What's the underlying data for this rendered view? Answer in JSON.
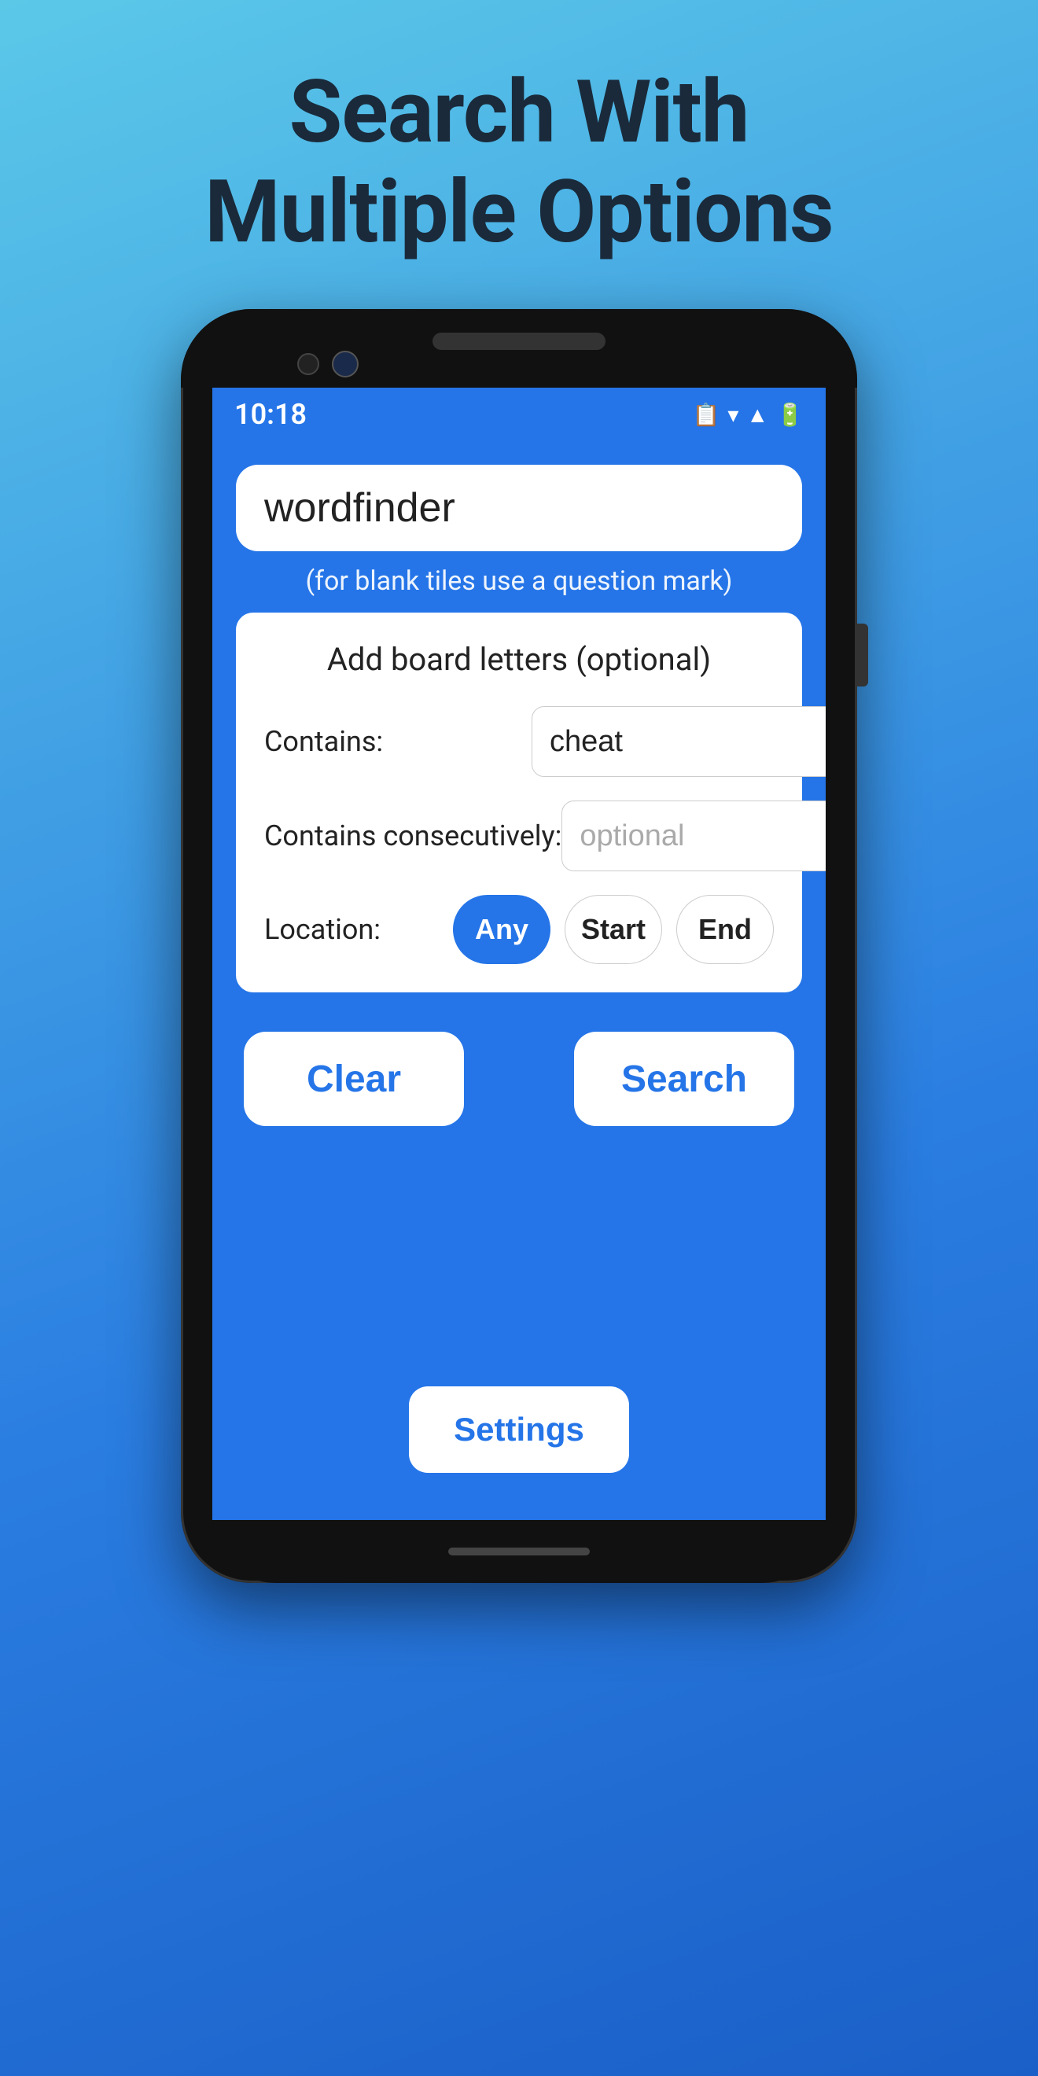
{
  "page": {
    "title_line1": "Search With",
    "title_line2": "Multiple Options"
  },
  "status_bar": {
    "time": "10:18",
    "wifi_icon": "▼",
    "signal_icon": "▲",
    "battery_icon": "▮"
  },
  "app": {
    "main_input": {
      "value": "wordfinder",
      "placeholder": "wordfinder"
    },
    "hint_text": "(for blank tiles use a question mark)",
    "card": {
      "title": "Add board letters (optional)",
      "contains_label": "Contains:",
      "contains_value": "cheat",
      "contains_consecutively_label": "Contains consecutively:",
      "contains_consecutively_placeholder": "optional",
      "location_label": "Location:",
      "location_buttons": [
        {
          "label": "Any",
          "active": true
        },
        {
          "label": "Start",
          "active": false
        },
        {
          "label": "End",
          "active": false
        }
      ]
    },
    "buttons": {
      "clear": "Clear",
      "search": "Search",
      "settings": "Settings"
    }
  }
}
